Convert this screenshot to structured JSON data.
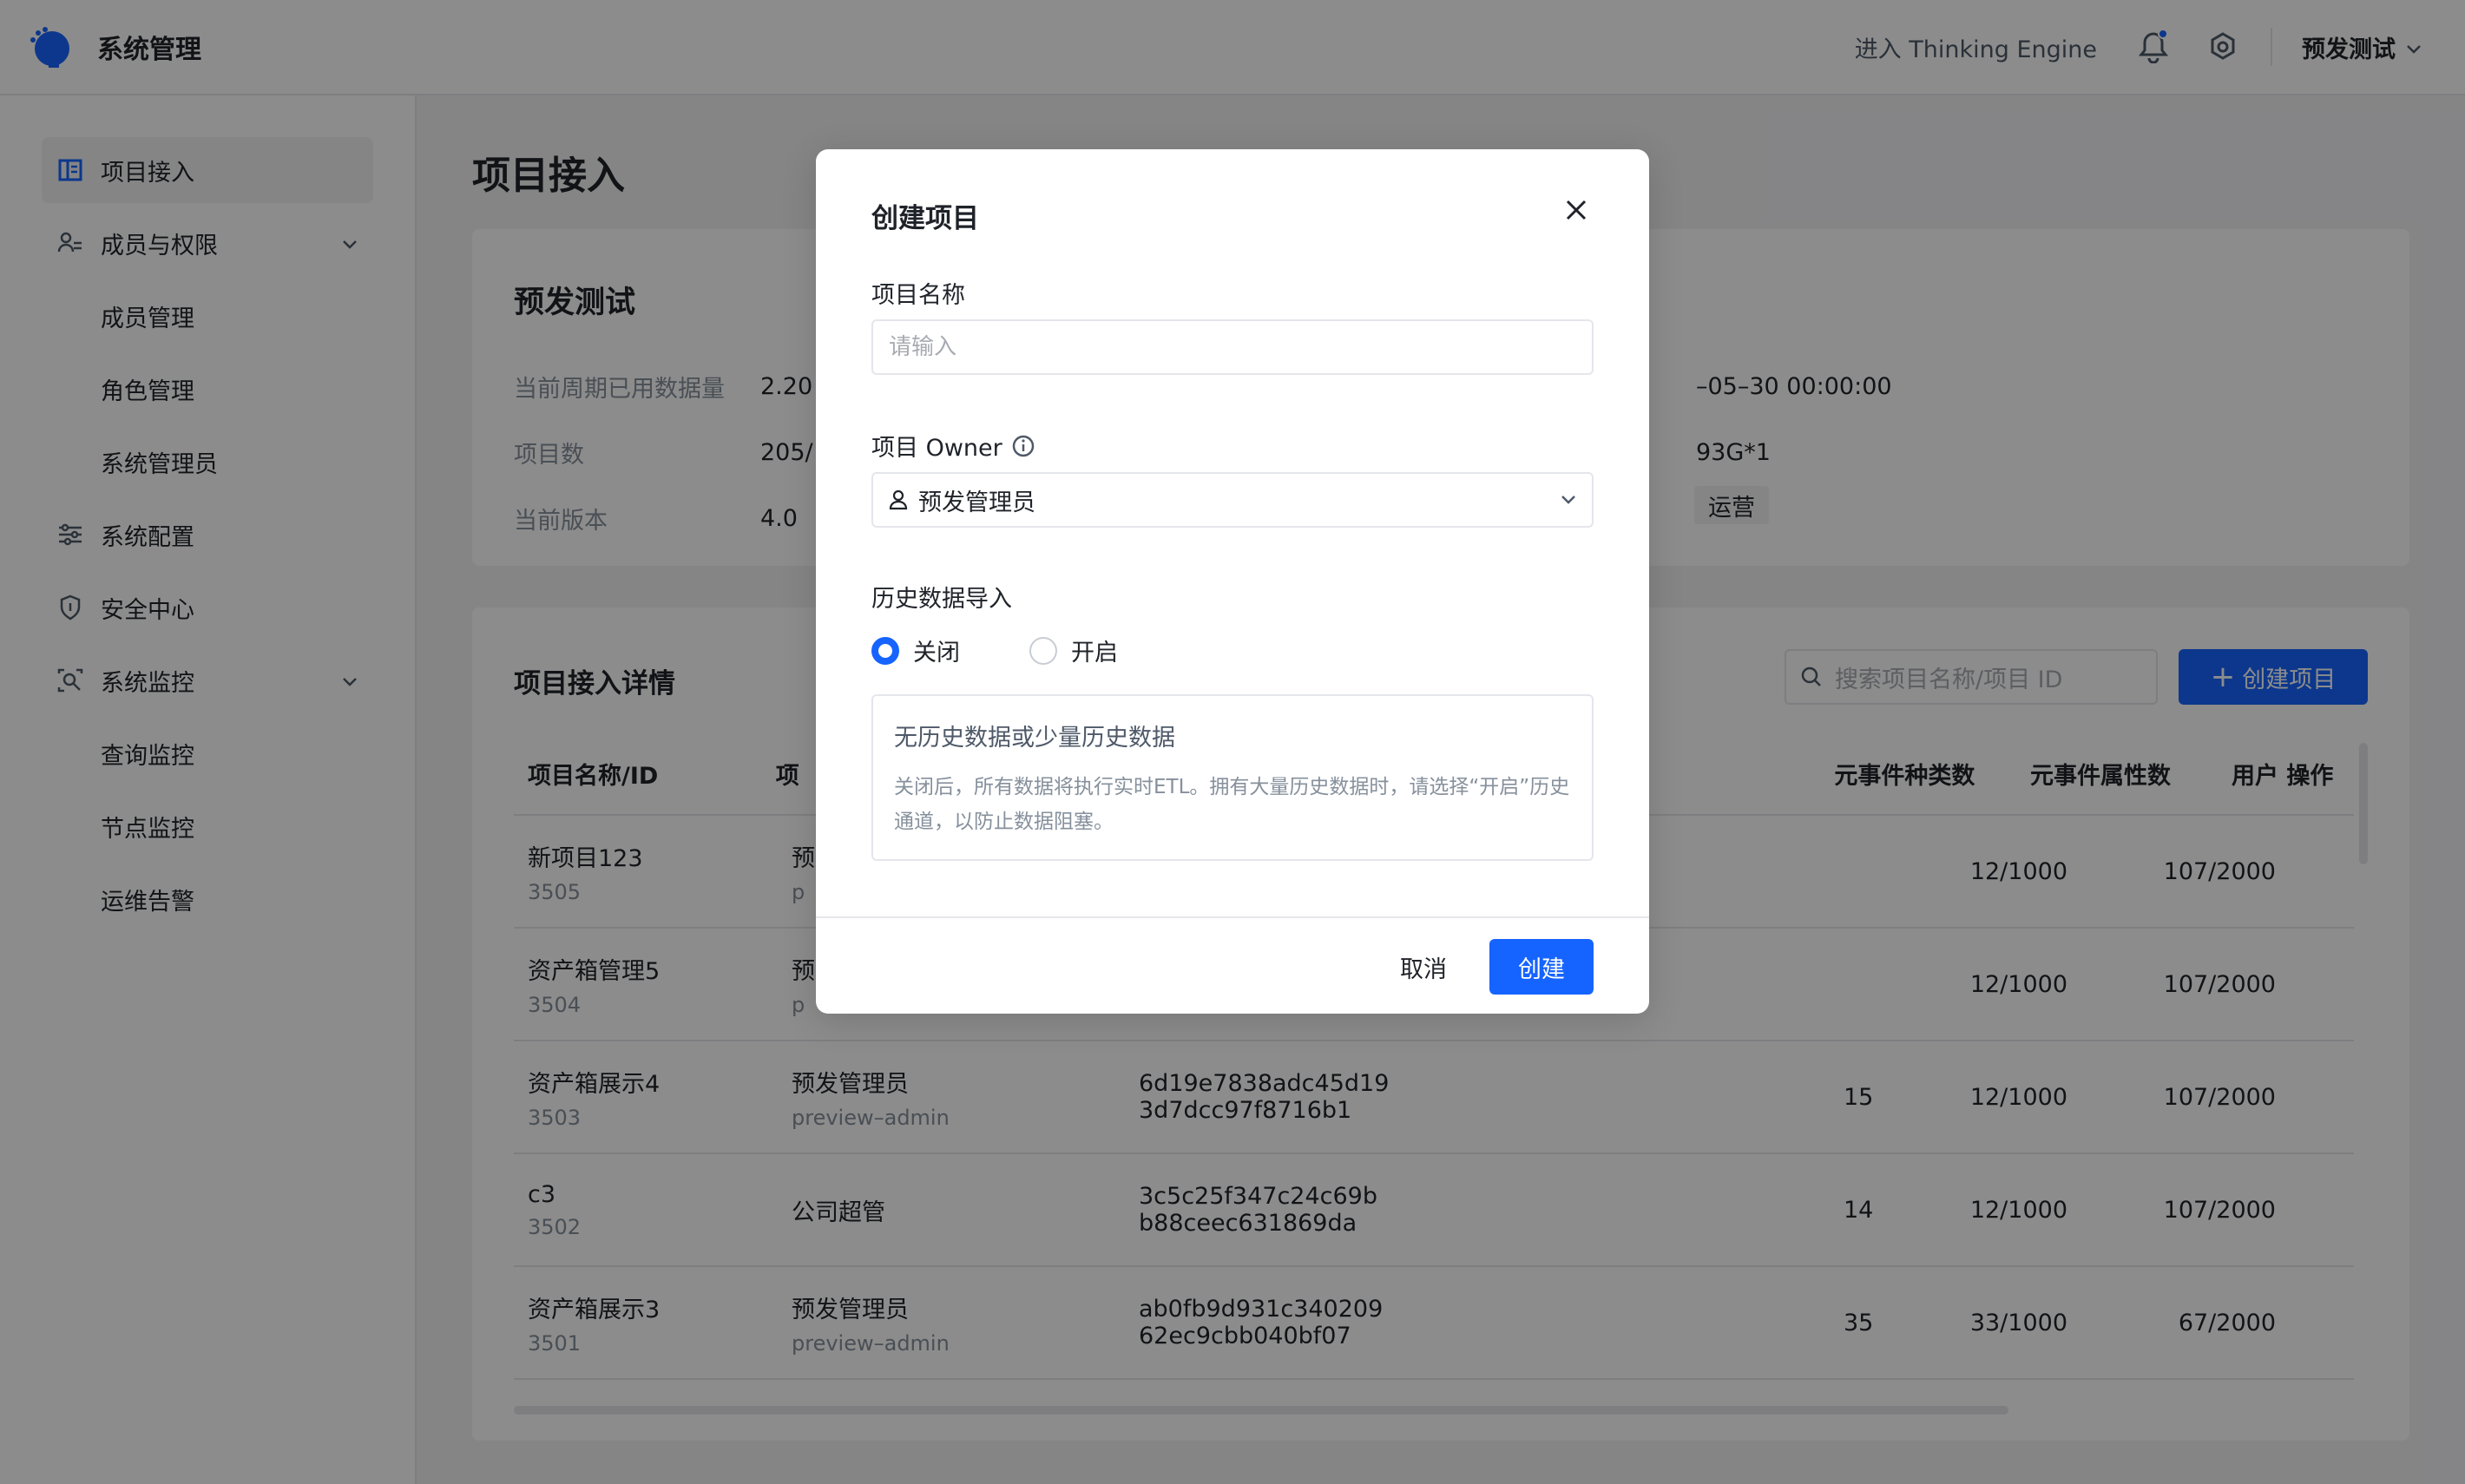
{
  "header": {
    "title": "系统管理",
    "enter_te": "进入 Thinking Engine",
    "env": "预发测试"
  },
  "sidebar": {
    "items": [
      {
        "label": "项目接入"
      },
      {
        "label": "成员与权限"
      },
      {
        "label": "成员管理"
      },
      {
        "label": "角色管理"
      },
      {
        "label": "系统管理员"
      },
      {
        "label": "系统配置"
      },
      {
        "label": "安全中心"
      },
      {
        "label": "系统监控"
      },
      {
        "label": "查询监控"
      },
      {
        "label": "节点监控"
      },
      {
        "label": "运维告警"
      }
    ]
  },
  "page": {
    "title": "项目接入"
  },
  "summary": {
    "title": "预发测试",
    "rows": [
      {
        "label": "当前周期已用数据量",
        "value": "2.20",
        "extra": "–05–30 00:00:00"
      },
      {
        "label": "项目数",
        "value": "205/",
        "extra": "93G*1"
      },
      {
        "label": "当前版本",
        "value": "4.0",
        "extra": ""
      }
    ],
    "tag": "运营"
  },
  "detail": {
    "title": "项目接入详情",
    "search_placeholder": "搜索项目名称/项目 ID",
    "create_label": "创建项目",
    "columns": [
      "项目名称/ID",
      "项",
      "",
      "",
      "元事件种类数",
      "元事件属性数",
      "用户 操作"
    ],
    "rows": [
      {
        "name": "新项目123",
        "id": "3505",
        "owner": "预",
        "owner_sub": "p",
        "token1": "",
        "token2": "",
        "n": "",
        "ev": "12/1000",
        "attr": "107/2000"
      },
      {
        "name": "资产箱管理5",
        "id": "3504",
        "owner": "预",
        "owner_sub": "p",
        "token1": "",
        "token2": "",
        "n": "",
        "ev": "12/1000",
        "attr": "107/2000"
      },
      {
        "name": "资产箱展示4",
        "id": "3503",
        "owner": "预发管理员",
        "owner_sub": "preview–admin",
        "token1": "6d19e7838adc45d19",
        "token2": "3d7dcc97f8716b1",
        "n": "15",
        "ev": "12/1000",
        "attr": "107/2000"
      },
      {
        "name": "c3",
        "id": "3502",
        "owner": "公司超管",
        "owner_sub": "",
        "token1": "3c5c25f347c24c69b",
        "token2": "b88ceec631869da",
        "n": "14",
        "ev": "12/1000",
        "attr": "107/2000"
      },
      {
        "name": "资产箱展示3",
        "id": "3501",
        "owner": "预发管理员",
        "owner_sub": "preview–admin",
        "token1": "ab0fb9d931c340209",
        "token2": "62ec9cbb040bf07",
        "n": "35",
        "ev": "33/1000",
        "attr": "67/2000"
      }
    ]
  },
  "modal": {
    "title": "创建项目",
    "name_label": "项目名称",
    "name_placeholder": "请输入",
    "owner_label": "项目 Owner",
    "owner_value": "预发管理员",
    "history_label": "历史数据导入",
    "radio_off": "关闭",
    "radio_on": "开启",
    "hint_title": "无历史数据或少量历史数据",
    "hint_desc": "关闭后，所有数据将执行实时ETL。拥有大量历史数据时，请选择“开启”历史通道，以防止数据阻塞。",
    "cancel": "取消",
    "create": "创建"
  },
  "colors": {
    "primary": "#1664ff",
    "overlay": "rgba(0,0,0,0.45)"
  }
}
